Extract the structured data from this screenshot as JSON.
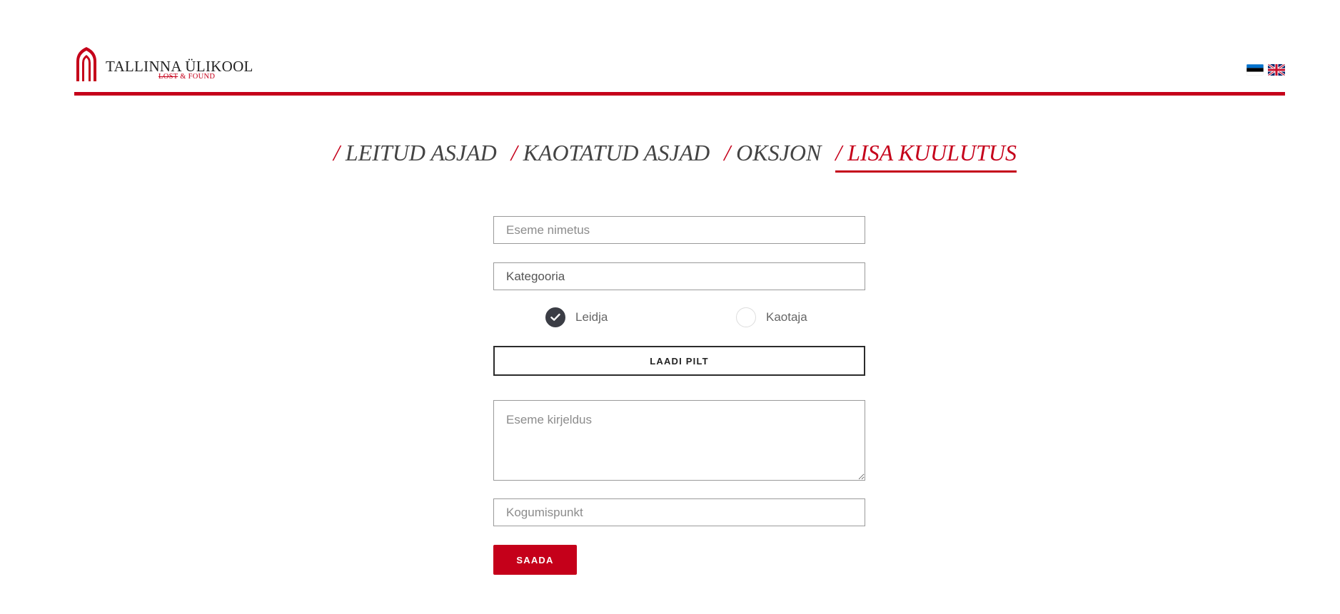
{
  "brand": {
    "title": "TALLINNA ÜLIKOOL",
    "subtitle_struck": "LOST",
    "subtitle_rest": " & FOUND",
    "accent_color": "#c5001a",
    "logo_icon": "gothic-arch-icon"
  },
  "languages": [
    {
      "code": "et",
      "icon": "estonia-flag-icon"
    },
    {
      "code": "en",
      "icon": "uk-flag-icon"
    }
  ],
  "nav": {
    "items": [
      {
        "slash": "/",
        "label": "LEITUD ASJAD",
        "active": false
      },
      {
        "slash": "/",
        "label": "KAOTATUD ASJAD",
        "active": false
      },
      {
        "slash": "/",
        "label": "OKSJON",
        "active": false
      },
      {
        "slash": "/",
        "label": "LISA KUULUTUS",
        "active": true
      }
    ]
  },
  "form": {
    "item_name_placeholder": "Eseme nimetus",
    "category_value": "Kategooria",
    "radios": [
      {
        "label": "Leidja",
        "checked": true
      },
      {
        "label": "Kaotaja",
        "checked": false
      }
    ],
    "upload_label": "LAADI PILT",
    "description_placeholder": "Eseme kirjeldus",
    "collection_point_placeholder": "Kogumispunkt",
    "submit_label": "SAADA"
  }
}
